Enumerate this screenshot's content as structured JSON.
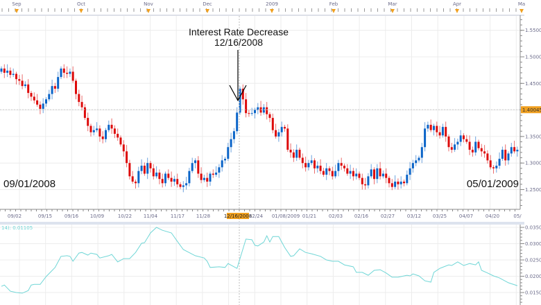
{
  "chart_data": [
    {
      "type": "candlestick",
      "title": "",
      "x_range": [
        "09/01/2008",
        "05/01/2009"
      ],
      "month_labels": [
        "Sep",
        "Oct",
        "Nov",
        "Dec",
        "2009",
        "Feb",
        "Mar",
        "Apr",
        "Ma"
      ],
      "x_tick_labels": [
        "09/02",
        "09/15",
        "09/16",
        "10/09",
        "10/22",
        "11/04",
        "11/17",
        "11/28",
        "12/16/2008",
        "12/24",
        "01/08/2009",
        "01/21",
        "02/03",
        "02/16",
        "02/27",
        "03/12",
        "03/25",
        "04/07",
        "04/20",
        "05/"
      ],
      "highlighted_x_label": "12/16/2008",
      "y_tick_labels": [
        "1.5500",
        "1.5000",
        "1.4500",
        "1.4000",
        "1.3500",
        "1.3000",
        "1.2500"
      ],
      "y_ticks": [
        1.55,
        1.5,
        1.45,
        1.4,
        1.35,
        1.3,
        1.25
      ],
      "ylim": [
        1.22,
        1.58
      ],
      "current_price_label": "1.40045",
      "current_price": 1.40045,
      "grid": true,
      "up_color": "#0a64c8",
      "down_color": "#dd0a0a",
      "first_open": 1.472,
      "closes": [
        1.478,
        1.47,
        1.474,
        1.466,
        1.468,
        1.458,
        1.455,
        1.445,
        1.448,
        1.432,
        1.425,
        1.418,
        1.41,
        1.402,
        1.412,
        1.42,
        1.43,
        1.445,
        1.44,
        1.462,
        1.478,
        1.47,
        1.468,
        1.472,
        1.455,
        1.43,
        1.415,
        1.405,
        1.385,
        1.37,
        1.358,
        1.362,
        1.365,
        1.35,
        1.345,
        1.362,
        1.372,
        1.365,
        1.355,
        1.348,
        1.335,
        1.322,
        1.3,
        1.275,
        1.265,
        1.262,
        1.285,
        1.295,
        1.28,
        1.3,
        1.29,
        1.275,
        1.282,
        1.27,
        1.262,
        1.28,
        1.272,
        1.265,
        1.27,
        1.26,
        1.255,
        1.258,
        1.262,
        1.285,
        1.3,
        1.305,
        1.28,
        1.268,
        1.272,
        1.265,
        1.28,
        1.278,
        1.282,
        1.292,
        1.305,
        1.308,
        1.33,
        1.345,
        1.36,
        1.395,
        1.44,
        1.42,
        1.394,
        1.393,
        1.394,
        1.4,
        1.405,
        1.395,
        1.405,
        1.392,
        1.385,
        1.362,
        1.35,
        1.358,
        1.368,
        1.365,
        1.325,
        1.32,
        1.31,
        1.325,
        1.31,
        1.3,
        1.292,
        1.3,
        1.305,
        1.29,
        1.295,
        1.285,
        1.278,
        1.29,
        1.285,
        1.275,
        1.285,
        1.3,
        1.295,
        1.29,
        1.28,
        1.285,
        1.275,
        1.28,
        1.272,
        1.26,
        1.258,
        1.275,
        1.288,
        1.27,
        1.29,
        1.275,
        1.28,
        1.272,
        1.262,
        1.255,
        1.265,
        1.26,
        1.265,
        1.262,
        1.278,
        1.29,
        1.3,
        1.305,
        1.31,
        1.33,
        1.365,
        1.372,
        1.362,
        1.37,
        1.358,
        1.352,
        1.368,
        1.35,
        1.33,
        1.325,
        1.335,
        1.34,
        1.352,
        1.345,
        1.34,
        1.325,
        1.32,
        1.34,
        1.328,
        1.322,
        1.318,
        1.305,
        1.292,
        1.29,
        1.295,
        1.308,
        1.325,
        1.305,
        1.318,
        1.33,
        1.322,
        1.325
      ],
      "annotation": {
        "line1": "Interest Rate Decrease",
        "line2": "12/16/2008"
      },
      "start_label": "09/01/2008",
      "end_label": "05/01/2009"
    },
    {
      "type": "line",
      "legend_label": "14): 0.01105",
      "color": "#6fd6d6",
      "y_tick_labels": [
        "0.03500",
        "0.03000",
        "0.02500",
        "0.02000",
        "0.01500"
      ],
      "y_ticks": [
        0.035,
        0.03,
        0.025,
        0.02,
        0.015
      ],
      "ylim": [
        0.0115,
        0.0363
      ],
      "points": [
        [
          0,
          0.0169
        ],
        [
          1,
          0.0173
        ],
        [
          3,
          0.0154
        ],
        [
          5,
          0.015
        ],
        [
          7,
          0.0148
        ],
        [
          9,
          0.0156
        ],
        [
          10,
          0.0173
        ],
        [
          11,
          0.0175
        ],
        [
          13,
          0.0175
        ],
        [
          15,
          0.0199
        ],
        [
          18,
          0.0227
        ],
        [
          20,
          0.0261
        ],
        [
          22,
          0.0263
        ],
        [
          23,
          0.0261
        ],
        [
          24,
          0.0246
        ],
        [
          26,
          0.0271
        ],
        [
          27,
          0.0273
        ],
        [
          29,
          0.0265
        ],
        [
          30,
          0.0271
        ],
        [
          32,
          0.0267
        ],
        [
          33,
          0.0256
        ],
        [
          36,
          0.0263
        ],
        [
          37,
          0.0267
        ],
        [
          39,
          0.0244
        ],
        [
          41,
          0.0254
        ],
        [
          43,
          0.0254
        ],
        [
          45,
          0.0273
        ],
        [
          47,
          0.0301
        ],
        [
          48,
          0.0303
        ],
        [
          50,
          0.0333
        ],
        [
          52,
          0.035
        ],
        [
          54,
          0.0341
        ],
        [
          57,
          0.0333
        ],
        [
          59,
          0.0307
        ],
        [
          61,
          0.0282
        ],
        [
          65,
          0.0263
        ],
        [
          68,
          0.0256
        ],
        [
          69,
          0.0246
        ],
        [
          70,
          0.0227
        ],
        [
          73,
          0.0229
        ],
        [
          75,
          0.0227
        ],
        [
          76,
          0.0239
        ],
        [
          79,
          0.0224
        ],
        [
          81,
          0.0284
        ],
        [
          82,
          0.0314
        ],
        [
          84,
          0.0312
        ],
        [
          85,
          0.0295
        ],
        [
          86,
          0.0293
        ],
        [
          88,
          0.0305
        ],
        [
          89,
          0.0324
        ],
        [
          90,
          0.0305
        ],
        [
          91,
          0.0322
        ],
        [
          93,
          0.0322
        ],
        [
          95,
          0.0288
        ],
        [
          97,
          0.0261
        ],
        [
          98,
          0.0263
        ],
        [
          100,
          0.0284
        ],
        [
          102,
          0.0273
        ],
        [
          104,
          0.0269
        ],
        [
          107,
          0.0261
        ],
        [
          109,
          0.025
        ],
        [
          111,
          0.0246
        ],
        [
          113,
          0.0246
        ],
        [
          115,
          0.0235
        ],
        [
          118,
          0.0229
        ],
        [
          119,
          0.0212
        ],
        [
          121,
          0.0212
        ],
        [
          123,
          0.0203
        ],
        [
          125,
          0.0218
        ],
        [
          127,
          0.022
        ],
        [
          129,
          0.021
        ],
        [
          131,
          0.0197
        ],
        [
          133,
          0.0197
        ],
        [
          136,
          0.0203
        ],
        [
          137,
          0.0201
        ],
        [
          138,
          0.0207
        ],
        [
          140,
          0.0201
        ],
        [
          142,
          0.0186
        ],
        [
          144,
          0.0182
        ],
        [
          145,
          0.0212
        ],
        [
          147,
          0.0224
        ],
        [
          150,
          0.0235
        ],
        [
          151,
          0.0233
        ],
        [
          153,
          0.0244
        ],
        [
          155,
          0.0233
        ],
        [
          157,
          0.0239
        ],
        [
          159,
          0.0235
        ],
        [
          160,
          0.0244
        ],
        [
          161,
          0.0218
        ],
        [
          163,
          0.021
        ],
        [
          165,
          0.0201
        ],
        [
          167,
          0.0195
        ],
        [
          170,
          0.018
        ],
        [
          173,
          0.0171
        ]
      ]
    }
  ]
}
